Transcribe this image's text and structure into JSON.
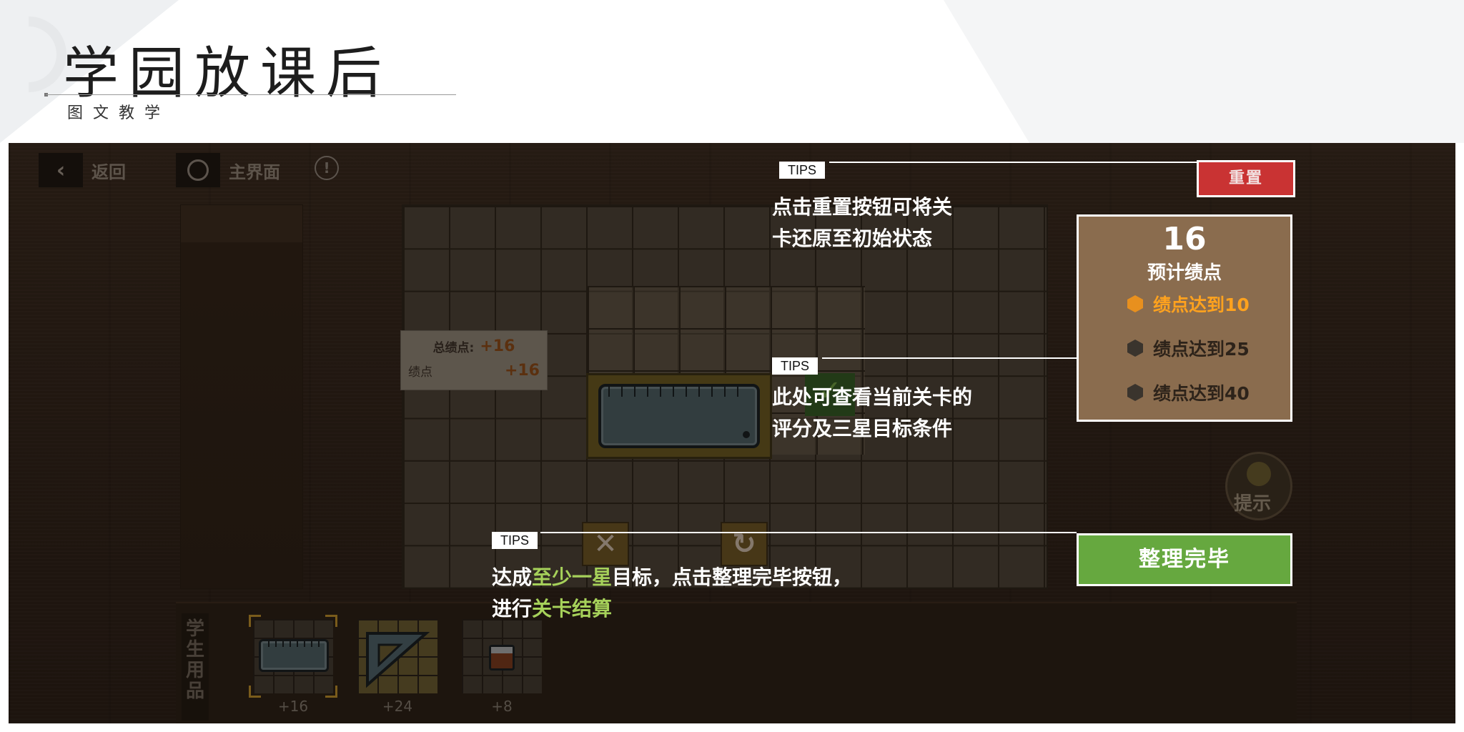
{
  "header": {
    "title": "学园放课后",
    "subtitle": "图文教学"
  },
  "topbar": {
    "back_label": "返回",
    "home_label": "主界面",
    "info_symbol": "!"
  },
  "score_panel": {
    "total_label": "总绩点:",
    "total_value": "+16",
    "points_label": "绩点",
    "points_value": "+16"
  },
  "reset_button": "重置",
  "star_panel": {
    "score": "16",
    "label": "预计绩点",
    "goals": [
      {
        "text": "绩点达到10",
        "achieved": true,
        "color": "#e8901e"
      },
      {
        "text": "绩点达到25",
        "achieved": false,
        "color": "#3a342d"
      },
      {
        "text": "绩点达到40",
        "achieved": false,
        "color": "#3a342d"
      }
    ]
  },
  "hint_label": "提示",
  "finish_button": "整理完毕",
  "tray": {
    "label": "学生用品",
    "items": [
      {
        "icon": "ruler-icon",
        "value": "+16",
        "selected": true
      },
      {
        "icon": "set-square-icon",
        "value": "+24",
        "selected": false
      },
      {
        "icon": "eraser-icon",
        "value": "+8",
        "selected": false
      }
    ]
  },
  "tips": {
    "tag": "TIPS",
    "reset_tip": [
      "点击重置按钮可将关",
      "卡还原至初始状态"
    ],
    "star_tip": [
      "此处可查看当前关卡的",
      "评分及三星目标条件"
    ],
    "finish_tip": {
      "line1_a": "达成",
      "line1_hl": "至少一星",
      "line1_b": "目标，点击整理完毕按钮，",
      "line2_a": "进行",
      "line2_hl": "关卡结算"
    }
  },
  "colors": {
    "highlight": "#a6d15a",
    "reset_red": "#c93333",
    "finish_green": "#66a83f"
  }
}
